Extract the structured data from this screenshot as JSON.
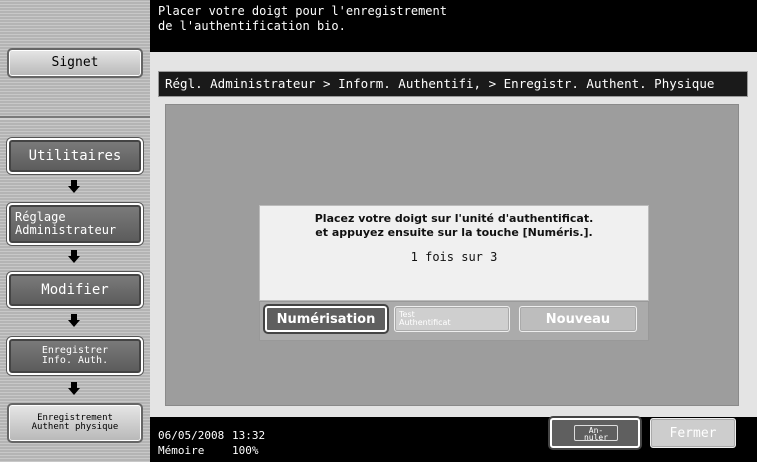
{
  "message": {
    "line1": "Placer votre doigt pour l'enregistrement",
    "line2": "de l'authentification bio."
  },
  "breadcrumb": "Régl. Administrateur > Inform. Authentifi, > Enregistr. Authent. Physique",
  "left": {
    "signet": "Signet",
    "utilitaires": "Utilitaires",
    "reglage_line1": "Réglage",
    "reglage_line2": "Administrateur",
    "modifier": "Modifier",
    "enreg_info_line1": "Enregistrer",
    "enreg_info_line2": "Info. Auth.",
    "enreg_auth_line1": "Enregistrement",
    "enreg_auth_line2": "Authent physique"
  },
  "dialog": {
    "line1": "Placez votre doigt sur l'unité d'authentificat.",
    "line2": "et appuyez ensuite sur la touche [Numéris.].",
    "count": "1 fois sur 3"
  },
  "actions": {
    "numerisation": "Numérisation",
    "test_line1": "Test",
    "test_line2": "Authentificat",
    "nouveau": "Nouveau"
  },
  "footer": {
    "date": "06/05/2008",
    "time": "13:32",
    "memory_label": "Mémoire",
    "memory_value": "100%",
    "annuler_line1": "An-",
    "annuler_line2": "nuler",
    "fermer": "Fermer"
  },
  "colors": {
    "header_bg": "#000000",
    "panel_bg": "#9d9d9d",
    "dialog_bg": "#f0f0f0",
    "active_button": "#5f5f5f",
    "disabled_button": "#cdcdcd"
  }
}
